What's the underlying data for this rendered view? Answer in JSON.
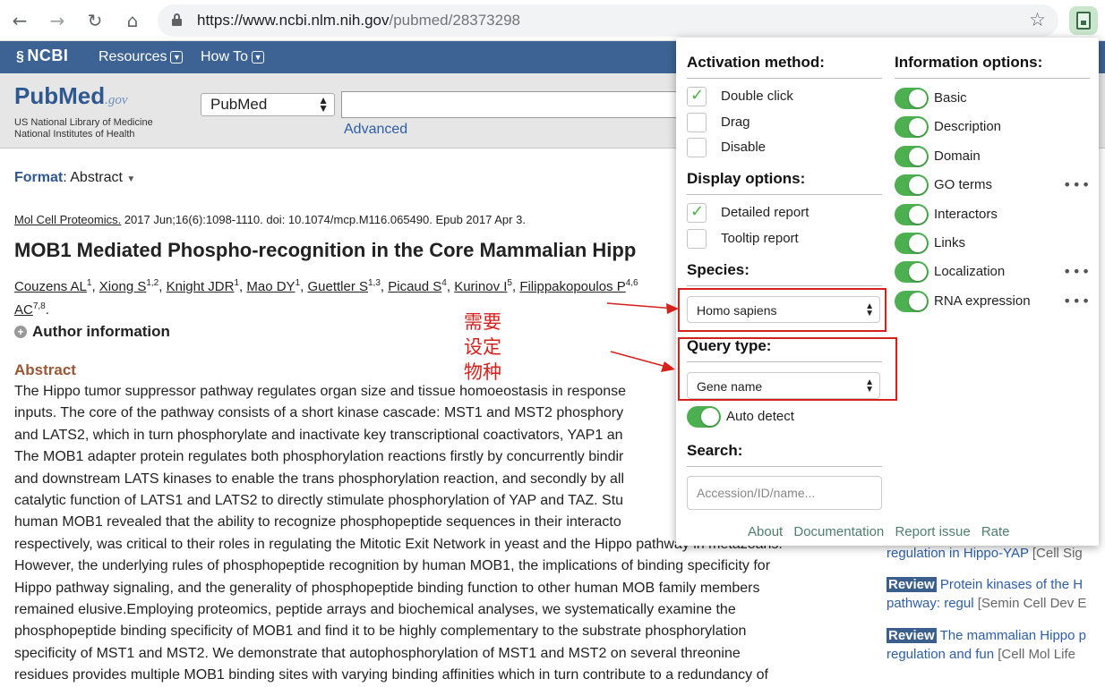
{
  "browser": {
    "url_host": "https://www.ncbi.nlm.nih.gov",
    "url_path": "/pubmed/28373298"
  },
  "ncbi_bar": {
    "logo": "NCBI",
    "menu": [
      "Resources",
      "How To"
    ]
  },
  "pubmed_header": {
    "logo_main": "PubMed",
    "logo_gov": ".gov",
    "sub_line1": "US National Library of Medicine",
    "sub_line2": "National Institutes of Health",
    "database": "PubMed",
    "advanced": "Advanced"
  },
  "article": {
    "format_label": "Format",
    "format_value": ": Abstract",
    "journal": "Mol Cell Proteomics.",
    "citation_rest": " 2017 Jun;16(6):1098-1110. doi: 10.1074/mcp.M116.065490. Epub 2017 Apr 3.",
    "title": "MOB1 Mediated Phospho-recognition in the Core Mammalian Hipp",
    "authors": [
      {
        "name": "Couzens AL",
        "sup": "1"
      },
      {
        "name": "Xiong S",
        "sup": "1,2"
      },
      {
        "name": "Knight JDR",
        "sup": "1"
      },
      {
        "name": "Mao DY",
        "sup": "1"
      },
      {
        "name": "Guettler S",
        "sup": "1,3"
      },
      {
        "name": "Picaud S",
        "sup": "4"
      },
      {
        "name": "Kurinov I",
        "sup": "5"
      },
      {
        "name": "Filippakopoulos P",
        "sup": "4,6"
      }
    ],
    "authors_line2_name": "AC",
    "authors_line2_sup": "7,8",
    "author_info": "Author information",
    "abstract_heading": "Abstract",
    "abstract_lines": [
      "The Hippo tumor suppressor pathway regulates organ size and tissue homoeostasis in response",
      "inputs. The core of the pathway consists of a short kinase cascade: MST1 and MST2 phosphory",
      "and LATS2, which in turn phosphorylate and inactivate key transcriptional coactivators, YAP1 an",
      "The MOB1 adapter protein regulates both phosphorylation reactions firstly by concurrently bindir",
      "and downstream LATS kinases to enable the trans phosphorylation reaction, and secondly by all",
      "catalytic function of LATS1 and LATS2 to directly stimulate phosphorylation of YAP and TAZ. Stu",
      "human MOB1 revealed that the ability to recognize phosphopeptide sequences in their interacto",
      "respectively, was critical to their roles in regulating the Mitotic Exit Network in yeast and the Hippo pathway in metazoans.",
      "However, the underlying rules of phosphopeptide recognition by human MOB1, the implications of binding specificity for",
      "Hippo pathway signaling, and the generality of phosphopeptide binding function to other human MOB family members",
      "remained elusive.Employing proteomics, peptide arrays and biochemical analyses, we systematically examine the",
      "phosphopeptide binding specificity of MOB1 and find it to be highly complementary to the substrate phosphorylation",
      "specificity of MST1 and MST2. We demonstrate that autophosphorylation of MST1 and MST2 on several threonine",
      "residues provides multiple MOB1 binding sites with varying binding affinities which in turn contribute to a redundancy of"
    ]
  },
  "sidebar": {
    "items": [
      {
        "badge": "",
        "text": "regulation in Hippo-YAP",
        "src": " [Cell Sig"
      },
      {
        "badge": "Review",
        "text": " Protein kinases of the H",
        "text2": "pathway: regul",
        "src": " [Semin Cell Dev E"
      },
      {
        "badge": "Review",
        "text": " The mammalian Hippo p",
        "text2": "regulation and fun ",
        "src": "[Cell Mol Life"
      }
    ]
  },
  "annotation": {
    "note_lines": [
      "需要",
      "设定",
      "物种"
    ],
    "color": "#d6201c"
  },
  "popup": {
    "activation": {
      "title": "Activation method:",
      "options": [
        {
          "label": "Double click",
          "checked": true
        },
        {
          "label": "Drag",
          "checked": false
        },
        {
          "label": "Disable",
          "checked": false
        }
      ]
    },
    "display": {
      "title": "Display options:",
      "options": [
        {
          "label": "Detailed report",
          "checked": true
        },
        {
          "label": "Tooltip report",
          "checked": false
        }
      ]
    },
    "species": {
      "title": "Species:",
      "value": "Homo sapiens"
    },
    "query": {
      "title": "Query type:",
      "value": "Gene name",
      "auto_detect": "Auto detect"
    },
    "search": {
      "title": "Search:",
      "placeholder": "Accession/ID/name..."
    },
    "info": {
      "title": "Information options:",
      "options": [
        {
          "label": "Basic",
          "more": ""
        },
        {
          "label": "Description",
          "more": ""
        },
        {
          "label": "Domain",
          "more": ""
        },
        {
          "label": "GO terms",
          "more": "•••"
        },
        {
          "label": "Interactors",
          "more": ""
        },
        {
          "label": "Links",
          "more": ""
        },
        {
          "label": "Localization",
          "more": "•••"
        },
        {
          "label": "RNA expression",
          "more": "•••"
        }
      ]
    },
    "footer": [
      "About",
      "Documentation",
      "Report issue",
      "Rate"
    ],
    "accent": "#4caf50"
  }
}
